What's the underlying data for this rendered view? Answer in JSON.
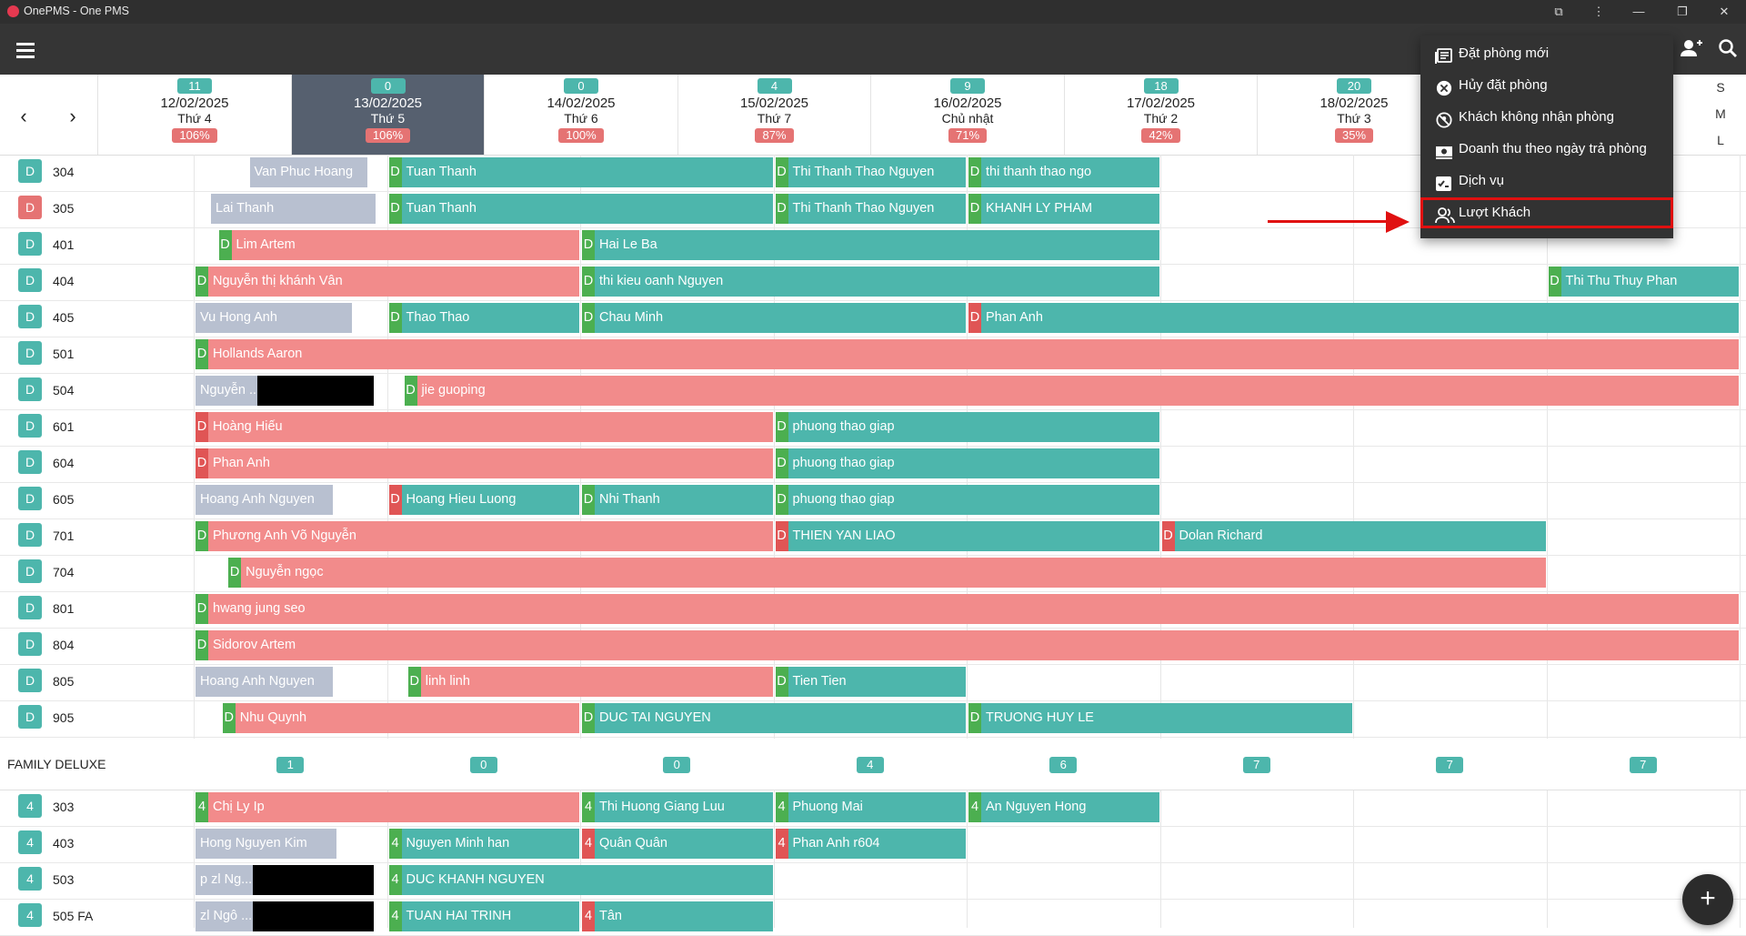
{
  "window": {
    "title": "OnePMS - One PMS",
    "controls": [
      "—",
      "❐",
      "✕"
    ]
  },
  "appbar": {
    "menu_icon": "hamburger-icon",
    "add_guest_icon": "person-add-icon",
    "search_icon": "search-icon"
  },
  "header": {
    "days": [
      {
        "avail": "11",
        "date": "12/02/2025",
        "dow": "Thứ 4",
        "occ": "106%"
      },
      {
        "avail": "0",
        "date": "13/02/2025",
        "dow": "Thứ 5",
        "occ": "106%"
      },
      {
        "avail": "0",
        "date": "14/02/2025",
        "dow": "Thứ 6",
        "occ": "100%"
      },
      {
        "avail": "4",
        "date": "15/02/2025",
        "dow": "Thứ 7",
        "occ": "87%"
      },
      {
        "avail": "9",
        "date": "16/02/2025",
        "dow": "Chủ nhật",
        "occ": "71%"
      },
      {
        "avail": "18",
        "date": "17/02/2025",
        "dow": "Thứ 2",
        "occ": "42%"
      },
      {
        "avail": "20",
        "date": "18/02/2025",
        "dow": "Thứ 3",
        "occ": "35%"
      }
    ],
    "size_options": [
      "S",
      "M",
      "L"
    ]
  },
  "rooms": [
    {
      "tag": "D",
      "dirty": false,
      "num": "304"
    },
    {
      "tag": "D",
      "dirty": true,
      "num": "305"
    },
    {
      "tag": "D",
      "dirty": false,
      "num": "401"
    },
    {
      "tag": "D",
      "dirty": false,
      "num": "404"
    },
    {
      "tag": "D",
      "dirty": false,
      "num": "405"
    },
    {
      "tag": "D",
      "dirty": false,
      "num": "501"
    },
    {
      "tag": "D",
      "dirty": false,
      "num": "504"
    },
    {
      "tag": "D",
      "dirty": false,
      "num": "601"
    },
    {
      "tag": "D",
      "dirty": false,
      "num": "604"
    },
    {
      "tag": "D",
      "dirty": false,
      "num": "605"
    },
    {
      "tag": "D",
      "dirty": false,
      "num": "701"
    },
    {
      "tag": "D",
      "dirty": false,
      "num": "704"
    },
    {
      "tag": "D",
      "dirty": false,
      "num": "801"
    },
    {
      "tag": "D",
      "dirty": false,
      "num": "804"
    },
    {
      "tag": "D",
      "dirty": false,
      "num": "805"
    },
    {
      "tag": "D",
      "dirty": false,
      "num": "905"
    }
  ],
  "bookings": [
    {
      "row": 0,
      "start": 0.28,
      "end": 0.88,
      "style": "grey",
      "tag": "",
      "name": "Van Phuc Hoang"
    },
    {
      "row": 0,
      "start": 1.0,
      "end": 3.0,
      "style": "green",
      "tag": "g",
      "name": "Tuan Thanh"
    },
    {
      "row": 0,
      "start": 3.0,
      "end": 4.0,
      "style": "green",
      "tag": "g",
      "name": "Thi Thanh Thao Nguyen"
    },
    {
      "row": 0,
      "start": 4.0,
      "end": 5.0,
      "style": "green",
      "tag": "g",
      "name": "thi thanh thao ngo"
    },
    {
      "row": 1,
      "start": 0.08,
      "end": 0.92,
      "style": "grey",
      "tag": "",
      "name": "Lai Thanh"
    },
    {
      "row": 1,
      "start": 1.0,
      "end": 3.0,
      "style": "green",
      "tag": "g",
      "name": "Tuan Thanh"
    },
    {
      "row": 1,
      "start": 3.0,
      "end": 4.0,
      "style": "green",
      "tag": "g",
      "name": "Thi Thanh Thao Nguyen"
    },
    {
      "row": 1,
      "start": 4.0,
      "end": 5.0,
      "style": "green",
      "tag": "g",
      "name": "KHANH LY PHAM"
    },
    {
      "row": 2,
      "start": 0.12,
      "end": 2.0,
      "style": "pink",
      "tag": "g",
      "name": "Lim Artem"
    },
    {
      "row": 2,
      "start": 2.0,
      "end": 5.0,
      "style": "green",
      "tag": "g",
      "name": "Hai Le Ba"
    },
    {
      "row": 3,
      "start": 0.0,
      "end": 2.0,
      "style": "pink",
      "tag": "g",
      "name": "Nguyễn thị khánh Vân"
    },
    {
      "row": 3,
      "start": 2.0,
      "end": 5.0,
      "style": "green",
      "tag": "g",
      "name": "thi kieu oanh Nguyen"
    },
    {
      "row": 3,
      "start": 7.0,
      "end": 8.0,
      "style": "green",
      "tag": "g",
      "name": "Thi Thu Thuy Phan"
    },
    {
      "row": 4,
      "start": 0.0,
      "end": 0.8,
      "style": "grey",
      "tag": "",
      "name": "Vu Hong Anh"
    },
    {
      "row": 4,
      "start": 1.0,
      "end": 2.0,
      "style": "green",
      "tag": "g",
      "name": "Thao Thao"
    },
    {
      "row": 4,
      "start": 2.0,
      "end": 4.0,
      "style": "green",
      "tag": "g",
      "name": "Chau Minh"
    },
    {
      "row": 4,
      "start": 4.0,
      "end": 8.0,
      "style": "green",
      "tag": "r",
      "name": "Phan Anh"
    },
    {
      "row": 5,
      "start": 0.0,
      "end": 8.0,
      "style": "pink",
      "tag": "g",
      "name": "Hollands Aaron"
    },
    {
      "row": 6,
      "start": 0.0,
      "end": 0.33,
      "style": "grey",
      "tag": "",
      "name": "Nguyễn ..."
    },
    {
      "row": 6,
      "start": 1.08,
      "end": 8.0,
      "style": "pink",
      "tag": "g",
      "name": "jie guoping"
    },
    {
      "row": 7,
      "start": 0.0,
      "end": 3.0,
      "style": "pink",
      "tag": "r",
      "name": "Hoàng Hiếu"
    },
    {
      "row": 7,
      "start": 3.0,
      "end": 5.0,
      "style": "green",
      "tag": "g",
      "name": "phuong thao giap"
    },
    {
      "row": 8,
      "start": 0.0,
      "end": 3.0,
      "style": "pink",
      "tag": "r",
      "name": "Phan Anh"
    },
    {
      "row": 8,
      "start": 3.0,
      "end": 5.0,
      "style": "green",
      "tag": "g",
      "name": "phuong thao giap"
    },
    {
      "row": 9,
      "start": 0.0,
      "end": 0.7,
      "style": "grey",
      "tag": "",
      "name": "Hoang Anh Nguyen"
    },
    {
      "row": 9,
      "start": 1.0,
      "end": 2.0,
      "style": "green",
      "tag": "r",
      "name": "Hoang Hieu Luong"
    },
    {
      "row": 9,
      "start": 2.0,
      "end": 3.0,
      "style": "green",
      "tag": "g",
      "name": "Nhi Thanh"
    },
    {
      "row": 9,
      "start": 3.0,
      "end": 5.0,
      "style": "green",
      "tag": "g",
      "name": "phuong thao giap"
    },
    {
      "row": 10,
      "start": 0.0,
      "end": 3.0,
      "style": "pink",
      "tag": "g",
      "name": "Phương Anh Võ Nguyễn"
    },
    {
      "row": 10,
      "start": 3.0,
      "end": 5.0,
      "style": "green",
      "tag": "r",
      "name": "THIEN YAN LIAO"
    },
    {
      "row": 10,
      "start": 5.0,
      "end": 7.0,
      "style": "green",
      "tag": "r",
      "name": "Dolan Richard"
    },
    {
      "row": 11,
      "start": 0.17,
      "end": 7.0,
      "style": "pink",
      "tag": "g",
      "name": "Nguyễn ngọc"
    },
    {
      "row": 12,
      "start": 0.0,
      "end": 8.0,
      "style": "pink",
      "tag": "g",
      "name": "hwang jung seo"
    },
    {
      "row": 13,
      "start": 0.0,
      "end": 8.0,
      "style": "pink",
      "tag": "g",
      "name": "Sidorov Artem"
    },
    {
      "row": 14,
      "start": 0.0,
      "end": 0.7,
      "style": "grey",
      "tag": "",
      "name": "Hoang Anh Nguyen"
    },
    {
      "row": 14,
      "start": 1.1,
      "end": 3.0,
      "style": "pink",
      "tag": "g",
      "name": "linh linh"
    },
    {
      "row": 14,
      "start": 3.0,
      "end": 4.0,
      "style": "green",
      "tag": "g",
      "name": "Tien Tien"
    },
    {
      "row": 15,
      "start": 0.14,
      "end": 2.0,
      "style": "pink",
      "tag": "g",
      "name": "Nhu Quynh"
    },
    {
      "row": 15,
      "start": 2.0,
      "end": 4.0,
      "style": "green",
      "tag": "g",
      "name": "DUC TAI NGUYEN"
    },
    {
      "row": 15,
      "start": 4.0,
      "end": 6.0,
      "style": "green",
      "tag": "g",
      "name": "TRUONG HUY LE"
    }
  ],
  "redactions_rows": [
    6
  ],
  "section": {
    "title": "FAMILY DELUXE",
    "counts": [
      "1",
      "0",
      "0",
      "4",
      "6",
      "7",
      "7",
      "7"
    ]
  },
  "family_rooms": [
    {
      "tag": "4",
      "num": "303"
    },
    {
      "tag": "4",
      "num": "403"
    },
    {
      "tag": "4",
      "num": "503"
    },
    {
      "tag": "4",
      "num": "505 FA"
    }
  ],
  "family_bookings": [
    {
      "row": 0,
      "start": 0.0,
      "end": 2.0,
      "style": "pink",
      "tag": "g",
      "tagtext": "4",
      "name": "Chị Ly Ip"
    },
    {
      "row": 0,
      "start": 2.0,
      "end": 3.0,
      "style": "green",
      "tag": "g",
      "tagtext": "4",
      "name": "Thi Huong Giang Luu"
    },
    {
      "row": 0,
      "start": 3.0,
      "end": 4.0,
      "style": "green",
      "tag": "g",
      "tagtext": "4",
      "name": "Phuong Mai"
    },
    {
      "row": 0,
      "start": 4.0,
      "end": 5.0,
      "style": "green",
      "tag": "g",
      "tagtext": "4",
      "name": "An Nguyen Hong"
    },
    {
      "row": 1,
      "start": 0.0,
      "end": 0.72,
      "style": "grey",
      "tag": "",
      "tagtext": "",
      "name": "Hong Nguyen Kim"
    },
    {
      "row": 1,
      "start": 1.0,
      "end": 2.0,
      "style": "green",
      "tag": "g",
      "tagtext": "4",
      "name": "Nguyen Minh han"
    },
    {
      "row": 1,
      "start": 2.0,
      "end": 3.0,
      "style": "green",
      "tag": "r",
      "tagtext": "4",
      "name": "Quân Quân"
    },
    {
      "row": 1,
      "start": 3.0,
      "end": 4.0,
      "style": "green",
      "tag": "r",
      "tagtext": "4",
      "name": "Phan Anh r604"
    },
    {
      "row": 2,
      "start": 0.0,
      "end": 0.3,
      "style": "grey",
      "tag": "",
      "tagtext": "",
      "name": "p zl Ng... n"
    },
    {
      "row": 2,
      "start": 1.0,
      "end": 3.0,
      "style": "green",
      "tag": "g",
      "tagtext": "4",
      "name": "DUC KHANH NGUYEN"
    },
    {
      "row": 3,
      "start": 0.0,
      "end": 0.3,
      "style": "grey",
      "tag": "",
      "tagtext": "",
      "name": "zl Ngô ... n"
    },
    {
      "row": 3,
      "start": 1.0,
      "end": 2.0,
      "style": "green",
      "tag": "g",
      "tagtext": "4",
      "name": "TUAN HAI TRINH"
    },
    {
      "row": 3,
      "start": 2.0,
      "end": 3.0,
      "style": "green",
      "tag": "r",
      "tagtext": "4",
      "name": "Tân"
    }
  ],
  "menu": {
    "items": [
      {
        "label": "Đặt phòng mới",
        "icon": "new-booking-icon"
      },
      {
        "label": "Hủy đặt phòng",
        "icon": "cancel-circle-icon"
      },
      {
        "label": "Khách không nhận phòng",
        "icon": "no-show-icon"
      },
      {
        "label": "Doanh thu theo ngày trả phòng",
        "icon": "revenue-icon"
      },
      {
        "label": "Dịch vụ",
        "icon": "service-icon"
      },
      {
        "label": "Lượt Khách",
        "icon": "guests-icon"
      }
    ],
    "highlighted_index": 5
  },
  "fab": {
    "label": "+"
  }
}
